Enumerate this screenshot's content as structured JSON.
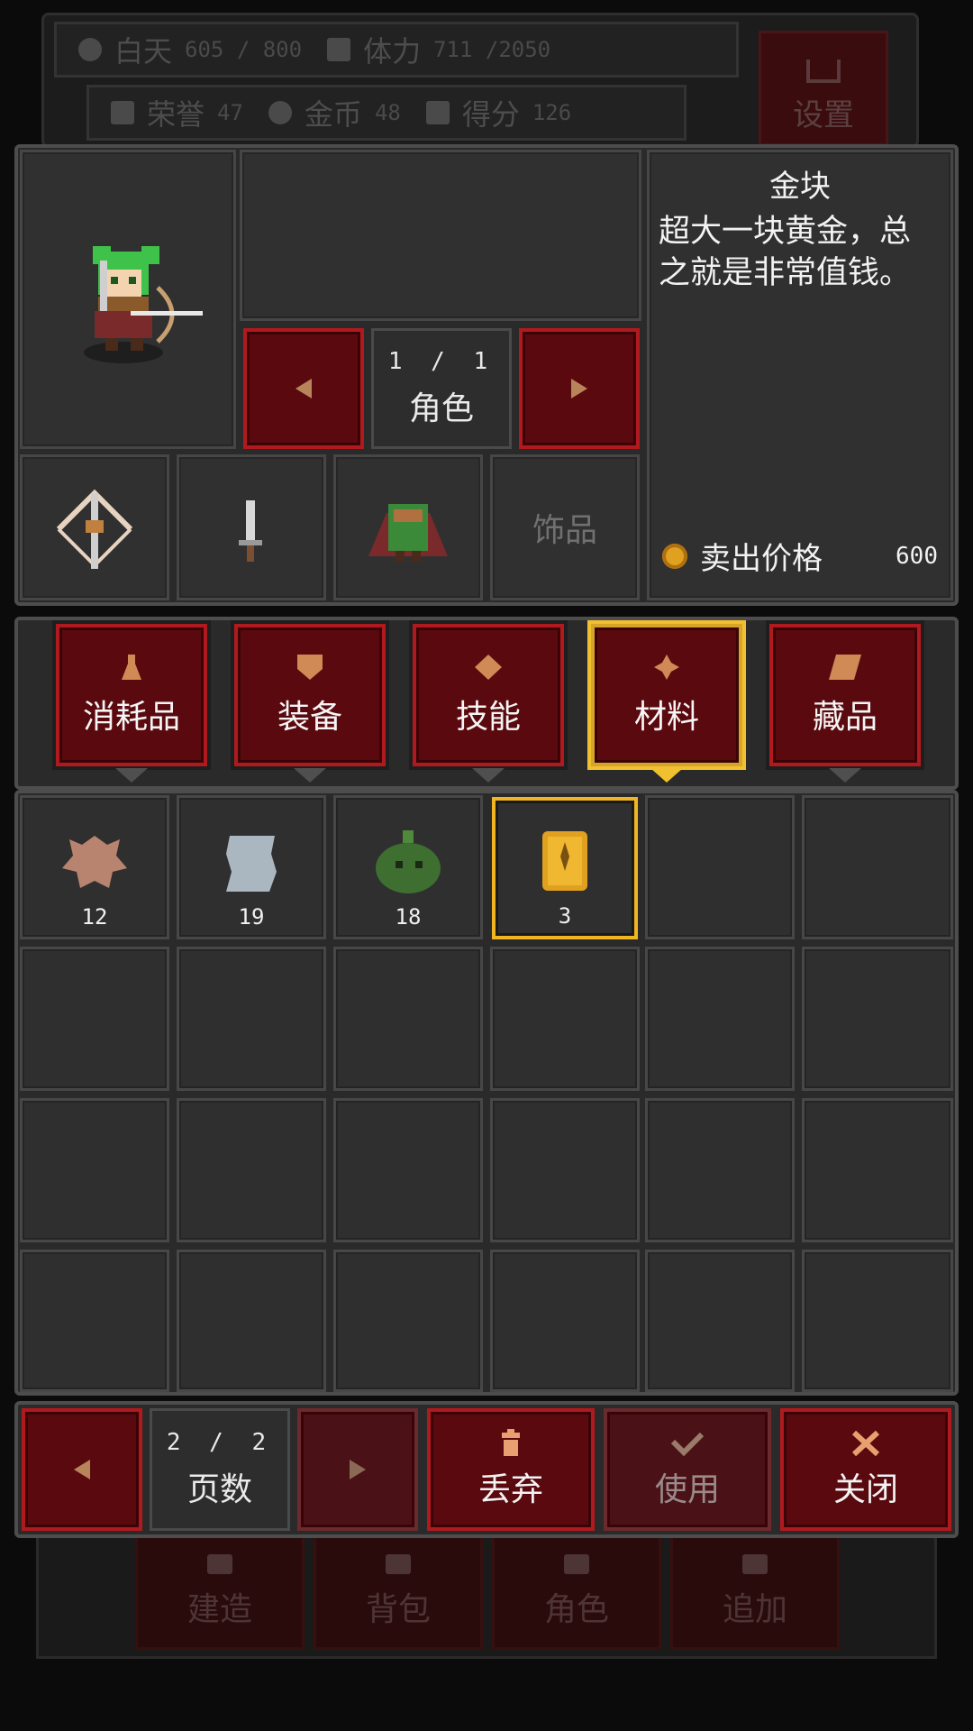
{
  "hud": {
    "day_label": "白天",
    "day_value": "605 / 800",
    "stamina_label": "体力",
    "stamina_value": "711 /2050",
    "honor_label": "荣誉",
    "honor_value": "47",
    "gold_label": "金币",
    "gold_value": "48",
    "score_label": "得分",
    "score_value": "126",
    "settings_label": "设置"
  },
  "character": {
    "page": "1 / 1",
    "page_label": "角色",
    "equipment_slots": [
      "crossbow-icon",
      "dagger-icon",
      "armor-icon",
      "饰品"
    ]
  },
  "item_detail": {
    "name": "金块",
    "description": "超大一块黄金，总之就是非常值钱。",
    "sell_label": "卖出价格",
    "sell_price": "600"
  },
  "tabs": [
    {
      "label": "消耗品",
      "icon": "potion-icon",
      "selected": false
    },
    {
      "label": "装备",
      "icon": "shield-icon",
      "selected": false
    },
    {
      "label": "技能",
      "icon": "diamond-icon",
      "selected": false
    },
    {
      "label": "材料",
      "icon": "cross-gem-icon",
      "selected": true
    },
    {
      "label": "藏品",
      "icon": "scroll-icon",
      "selected": false
    }
  ],
  "inventory": [
    {
      "icon": "leather-hide-icon",
      "qty": "12",
      "selected": false
    },
    {
      "icon": "cloth-icon",
      "qty": "19",
      "selected": false
    },
    {
      "icon": "green-slime-icon",
      "qty": "18",
      "selected": false
    },
    {
      "icon": "gold-nugget-icon",
      "qty": "3",
      "selected": true
    }
  ],
  "pager": {
    "page": "2 / 2",
    "label": "页数"
  },
  "actions": {
    "discard": "丢弃",
    "use": "使用",
    "close": "关闭"
  },
  "bottom_nav": [
    "建造",
    "背包",
    "角色",
    "追加"
  ],
  "colors": {
    "accent_red": "#b01a1f",
    "selected_gold": "#f0b520",
    "panel_bg": "#2a2a2a"
  }
}
